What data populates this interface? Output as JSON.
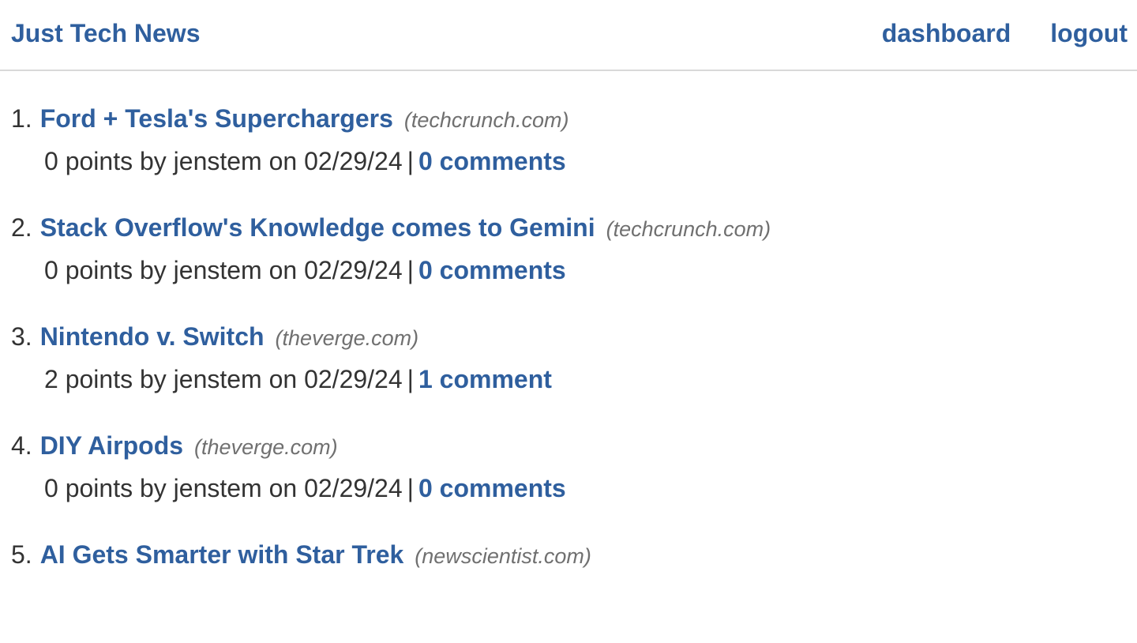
{
  "header": {
    "brand": "Just Tech News",
    "nav": {
      "dashboard": "dashboard",
      "logout": "logout"
    }
  },
  "posts": [
    {
      "number": "1.",
      "title": "Ford + Tesla's Superchargers",
      "domain": "(techcrunch.com)",
      "points": "0",
      "points_label": "points by",
      "author": "jenstem",
      "on_label": "on",
      "date": "02/29/24",
      "separator": "|",
      "comments": "0 comments"
    },
    {
      "number": "2.",
      "title": "Stack Overflow's Knowledge comes to Gemini",
      "domain": "(techcrunch.com)",
      "points": "0",
      "points_label": "points by",
      "author": "jenstem",
      "on_label": "on",
      "date": "02/29/24",
      "separator": "|",
      "comments": "0 comments"
    },
    {
      "number": "3.",
      "title": "Nintendo v. Switch",
      "domain": "(theverge.com)",
      "points": "2",
      "points_label": "points by",
      "author": "jenstem",
      "on_label": "on",
      "date": "02/29/24",
      "separator": "|",
      "comments": "1 comment"
    },
    {
      "number": "4.",
      "title": "DIY Airpods",
      "domain": "(theverge.com)",
      "points": "0",
      "points_label": "points by",
      "author": "jenstem",
      "on_label": "on",
      "date": "02/29/24",
      "separator": "|",
      "comments": "0 comments"
    },
    {
      "number": "5.",
      "title": "AI Gets Smarter with Star Trek",
      "domain": "(newscientist.com)"
    }
  ]
}
